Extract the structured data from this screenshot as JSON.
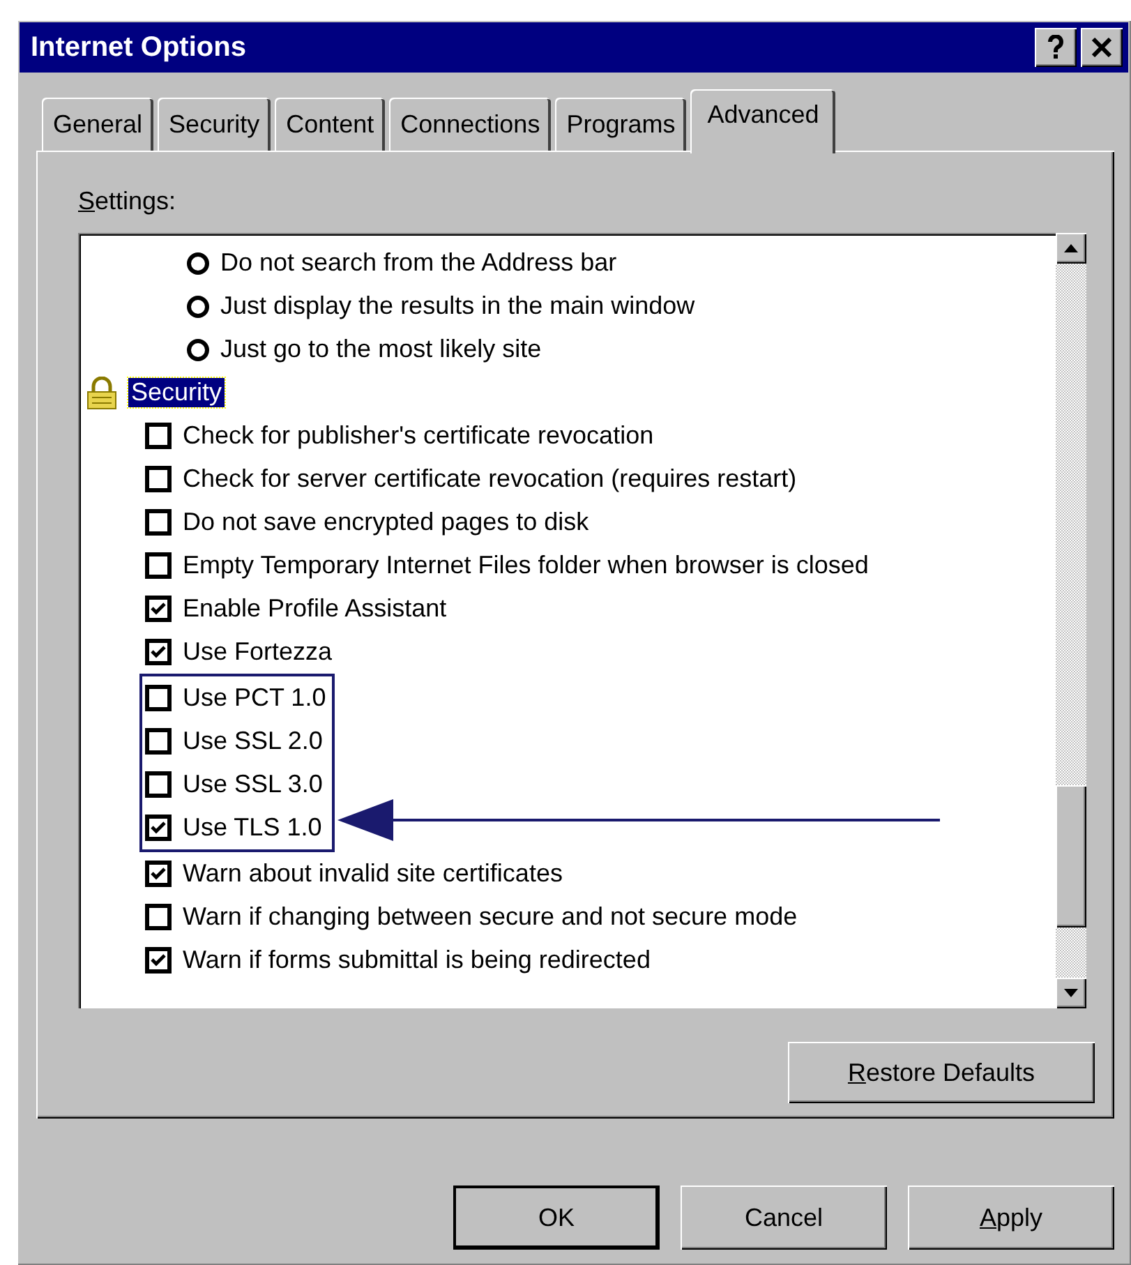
{
  "window": {
    "title": "Internet Options"
  },
  "tabs": [
    {
      "label": "General",
      "selected": false
    },
    {
      "label": "Security",
      "selected": false
    },
    {
      "label": "Content",
      "selected": false
    },
    {
      "label": "Connections",
      "selected": false
    },
    {
      "label": "Programs",
      "selected": false
    },
    {
      "label": "Advanced",
      "selected": true
    }
  ],
  "settings_label": {
    "text": "Settings:",
    "underline_first": true
  },
  "settings": [
    {
      "kind": "radio",
      "label": "Do not search from the Address bar",
      "selected": false
    },
    {
      "kind": "radio",
      "label": "Just display the results in the main window",
      "selected": false
    },
    {
      "kind": "radio",
      "label": "Just go to the most likely site",
      "selected": false
    },
    {
      "kind": "group",
      "label": "Security",
      "selected": true,
      "children": [
        {
          "kind": "checkbox",
          "label": "Check for publisher's certificate revocation",
          "checked": false,
          "highlighted": false
        },
        {
          "kind": "checkbox",
          "label": "Check for server certificate revocation (requires restart)",
          "checked": false,
          "highlighted": false
        },
        {
          "kind": "checkbox",
          "label": "Do not save encrypted pages to disk",
          "checked": false,
          "highlighted": false
        },
        {
          "kind": "checkbox",
          "label": "Empty Temporary Internet Files folder when browser is closed",
          "checked": false,
          "highlighted": false
        },
        {
          "kind": "checkbox",
          "label": "Enable Profile Assistant",
          "checked": true,
          "highlighted": false
        },
        {
          "kind": "checkbox",
          "label": "Use Fortezza",
          "checked": true,
          "highlighted": false
        },
        {
          "kind": "checkbox",
          "label": "Use PCT 1.0",
          "checked": false,
          "highlighted": true
        },
        {
          "kind": "checkbox",
          "label": "Use SSL 2.0",
          "checked": false,
          "highlighted": true
        },
        {
          "kind": "checkbox",
          "label": "Use SSL 3.0",
          "checked": false,
          "highlighted": true
        },
        {
          "kind": "checkbox",
          "label": "Use TLS 1.0",
          "checked": true,
          "highlighted": true,
          "pointed_at": true
        },
        {
          "kind": "checkbox",
          "label": "Warn about invalid site certificates",
          "checked": true,
          "highlighted": false
        },
        {
          "kind": "checkbox",
          "label": "Warn if changing between secure and not secure mode",
          "checked": false,
          "highlighted": false
        },
        {
          "kind": "checkbox",
          "label": "Warn if forms submittal is being redirected",
          "checked": true,
          "highlighted": false
        }
      ]
    }
  ],
  "restore_button": {
    "label": "Restore Defaults",
    "underline_first": true
  },
  "buttons": [
    {
      "label": "OK",
      "underline_first": false,
      "default": true
    },
    {
      "label": "Cancel",
      "underline_first": false,
      "default": false
    },
    {
      "label": "Apply",
      "underline_first": true,
      "default": false
    }
  ]
}
